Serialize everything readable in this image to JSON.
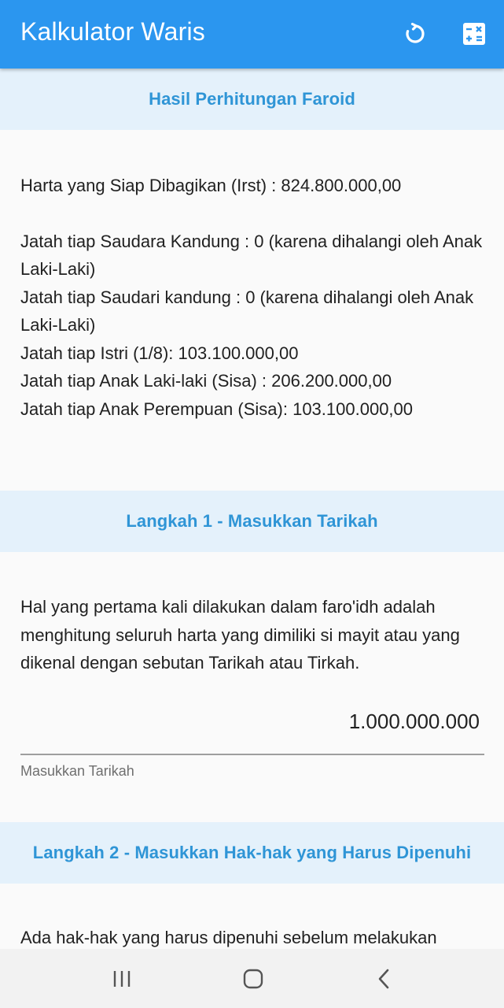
{
  "appbar": {
    "title": "Kalkulator Waris",
    "actions": [
      {
        "icon": "refresh-icon",
        "label": "Reset"
      },
      {
        "icon": "calculator-icon",
        "label": "Hitung"
      }
    ],
    "color": "#2b96ef"
  },
  "result_section": {
    "header": "Hasil Perhitungan Faroid",
    "harta_line": "Harta yang Siap Dibagikan (Irst) : 824.800.000,00",
    "lines": [
      "Jatah tiap Saudara Kandung : 0 (karena dihalangi oleh Anak Laki-Laki)",
      "Jatah tiap Saudari kandung : 0 (karena dihalangi oleh Anak Laki-Laki)",
      "Jatah tiap Istri (1/8): 103.100.000,00",
      "Jatah tiap Anak Laki-laki (Sisa) : 206.200.000,00",
      "Jatah tiap Anak Perempuan (Sisa): 103.100.000,00"
    ]
  },
  "step1": {
    "header": "Langkah 1 - Masukkan Tarikah",
    "description": "Hal yang pertama kali dilakukan dalam faro'idh adalah menghitung seluruh harta yang dimiliki si mayit atau yang dikenal dengan sebutan Tarikah atau Tirkah.",
    "input_value": "1.000.000.000",
    "input_label": "Masukkan Tarikah"
  },
  "step2": {
    "header": "Langkah 2 - Masukkan Hak-hak yang Harus Dipenuhi",
    "description_partial": "Ada hak-hak yang harus dipenuhi sebelum melakukan"
  },
  "navbar": {
    "buttons": [
      "recents-icon",
      "home-icon",
      "back-icon"
    ]
  }
}
